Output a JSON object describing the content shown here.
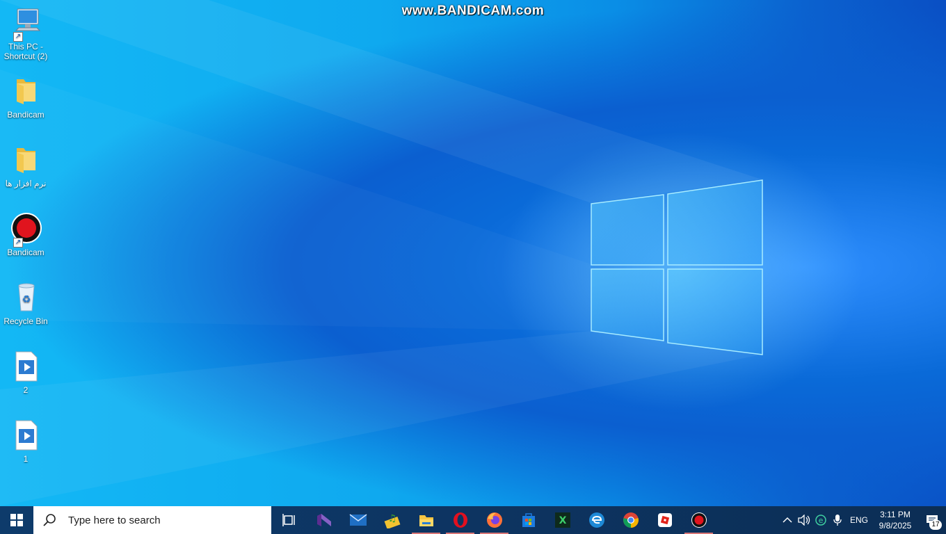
{
  "watermark": "www.BANDICAM.com",
  "desktop_icons": [
    {
      "label_line1": "This PC -",
      "label_line2": "Shortcut (2)",
      "icon": "computer-icon"
    },
    {
      "label_line1": "Bandicam",
      "label_line2": "",
      "icon": "folder-icon"
    },
    {
      "label_line1": "نرم افزار ها",
      "label_line2": "",
      "icon": "folder-icon"
    },
    {
      "label_line1": "Bandicam",
      "label_line2": "",
      "icon": "bandicam-record-icon"
    },
    {
      "label_line1": "Recycle Bin",
      "label_line2": "",
      "icon": "recycle-bin-icon"
    },
    {
      "label_line1": "2",
      "label_line2": "",
      "icon": "video-file-icon"
    },
    {
      "label_line1": "1",
      "label_line2": "",
      "icon": "video-file-icon"
    }
  ],
  "taskbar": {
    "search_placeholder": "Type here to search",
    "apps": [
      {
        "name": "task-view-icon"
      },
      {
        "name": "visual-studio-icon"
      },
      {
        "name": "mail-icon"
      },
      {
        "name": "music-app-icon"
      },
      {
        "name": "file-explorer-icon",
        "active": true
      },
      {
        "name": "opera-icon",
        "active": true
      },
      {
        "name": "firefox-icon",
        "active": true
      },
      {
        "name": "microsoft-store-icon"
      },
      {
        "name": "excel-like-icon"
      },
      {
        "name": "edge-icon"
      },
      {
        "name": "chrome-icon"
      },
      {
        "name": "roblox-icon"
      },
      {
        "name": "bandicam-icon",
        "active": true
      }
    ]
  },
  "tray": {
    "language": "ENG",
    "time": "3:11 PM",
    "date": "9/8/2025",
    "notifications_count": "17"
  },
  "colors": {
    "taskbar": "#0d3461",
    "accent_underline": "#d97777",
    "bandicam_red": "#e0141e"
  }
}
